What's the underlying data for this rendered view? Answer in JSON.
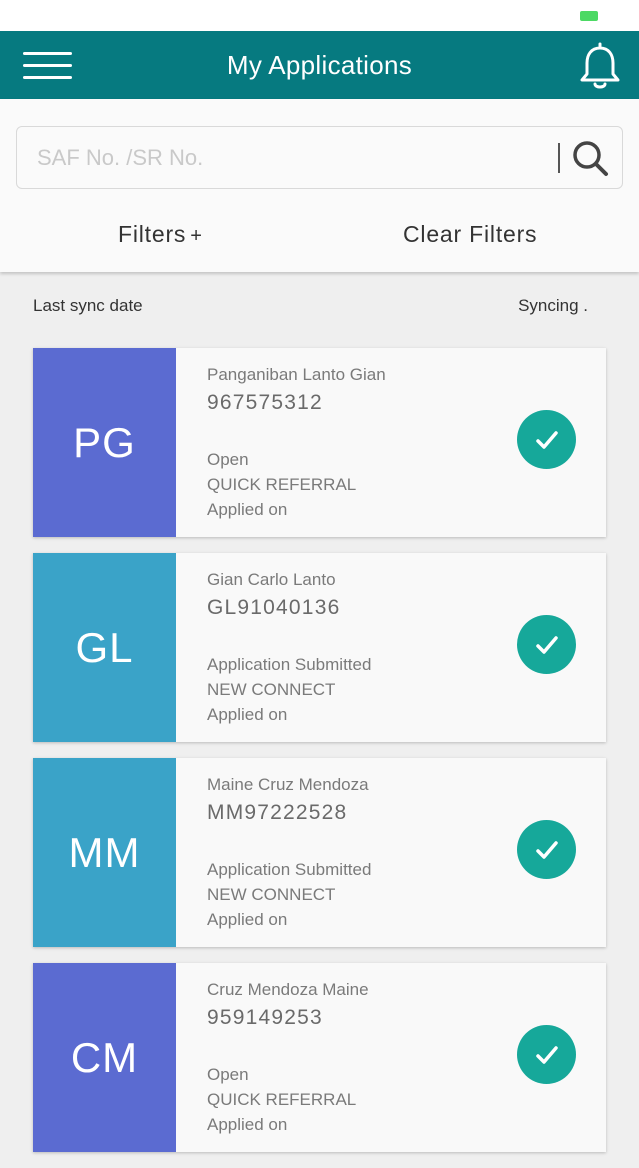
{
  "header": {
    "title": "My Applications",
    "menu_icon": "hamburger-menu-icon",
    "notification_icon": "bell-icon",
    "color": "#067a80"
  },
  "search": {
    "placeholder": "SAF No. /SR No.",
    "value": "",
    "icon": "search-icon"
  },
  "filters": {
    "filters_label": "Filters",
    "filters_plus": "+",
    "clear_label": "Clear Filters"
  },
  "sync": {
    "label": "Last sync date",
    "status": "Syncing ."
  },
  "applications": [
    {
      "initials": "PG",
      "name": "Panganiban Lanto Gian",
      "id": "967575312",
      "status": "Open",
      "type": "QUICK REFERRAL",
      "applied": "Applied on",
      "avatar_color": "#5b6bd1"
    },
    {
      "initials": "GL",
      "name": "Gian Carlo Lanto",
      "id": "GL91040136",
      "status": "Application Submitted",
      "type": "NEW CONNECT",
      "applied": "Applied on",
      "avatar_color": "#3aa3c8"
    },
    {
      "initials": "MM",
      "name": "Maine Cruz Mendoza",
      "id": "MM97222528",
      "status": "Application Submitted",
      "type": "NEW CONNECT",
      "applied": "Applied on",
      "avatar_color": "#3aa3c8"
    },
    {
      "initials": "CM",
      "name": "Cruz Mendoza Maine",
      "id": "959149253",
      "status": "Open",
      "type": "QUICK REFERRAL",
      "applied": "Applied on",
      "avatar_color": "#5b6bd1"
    }
  ],
  "colors": {
    "check": "#16a89a",
    "battery": "#4cd964"
  }
}
